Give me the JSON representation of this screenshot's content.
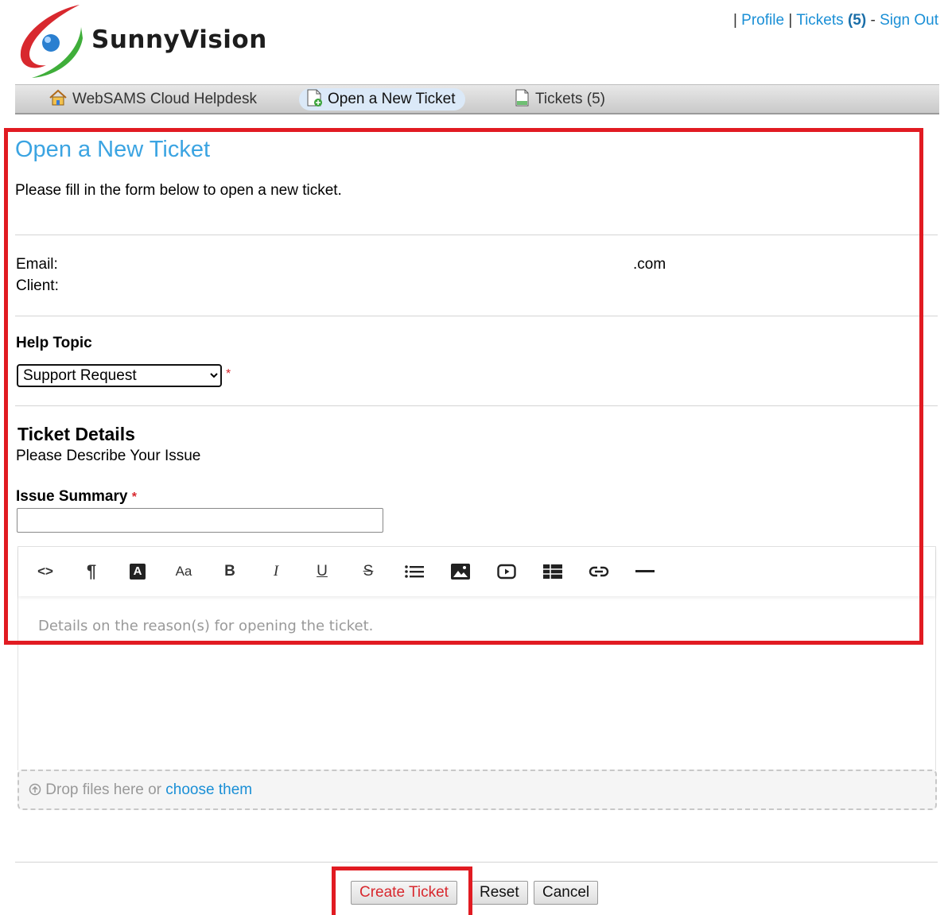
{
  "brand": {
    "name": "SunnyVision"
  },
  "toplinks": {
    "sep": "|",
    "profile": "Profile",
    "tickets": "Tickets",
    "tickets_count": "(5)",
    "dash": "-",
    "signout": "Sign Out"
  },
  "nav": {
    "items": [
      {
        "label": "WebSAMS Cloud Helpdesk",
        "icon": "home-icon"
      },
      {
        "label": "Open a New Ticket",
        "icon": "new-ticket-icon"
      },
      {
        "label": "Tickets (5)",
        "icon": "tickets-icon"
      }
    ]
  },
  "main": {
    "title": "Open a New Ticket",
    "intro": "Please fill in the form below to open a new ticket.",
    "email_label": "Email:",
    "email_value": ".com",
    "client_label": "Client:",
    "help_topic_label": "Help Topic",
    "help_topic_selected": "Support Request",
    "required_mark": "*",
    "ticket_details_title": "Ticket Details",
    "ticket_details_subtitle": "Please Describe Your Issue",
    "issue_summary_label": "Issue Summary",
    "issue_summary_value": "",
    "editor_placeholder": "Details on the reason(s) for opening the ticket.",
    "toolbar": {
      "code": "<>",
      "paragraph": "¶",
      "font_color": "A",
      "font_size": "Aa",
      "bold": "B",
      "italic": "I",
      "underline": "U",
      "strike": "S"
    },
    "dropzone": {
      "text": "Drop files here or",
      "link": "choose them"
    }
  },
  "buttons": {
    "create": "Create Ticket",
    "reset": "Reset",
    "cancel": "Cancel"
  },
  "colors": {
    "accent": "#3ba4e2",
    "link": "#1a8fd6",
    "highlight": "#e11b22",
    "required": "#d8282e"
  }
}
